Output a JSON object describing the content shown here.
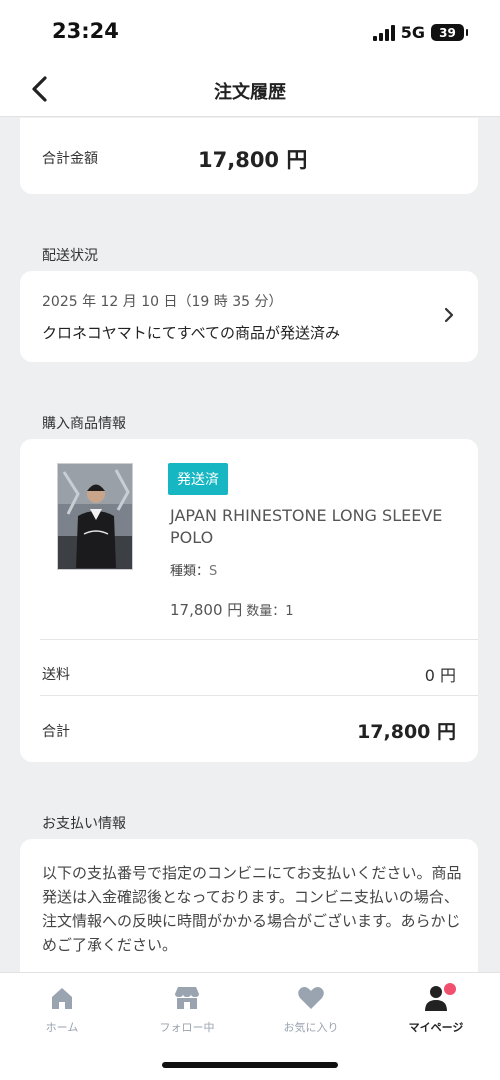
{
  "status_bar": {
    "time": "23:24",
    "network": "5G",
    "battery": "39"
  },
  "nav": {
    "title": "注文履歴"
  },
  "order_total": {
    "label": "合計金額",
    "value": "17,800 円"
  },
  "shipping": {
    "section_title": "配送状況",
    "date": "2025 年 12 月 10 日（19 時 35 分）",
    "status": "クロネコヤマトにてすべての商品が発送済み"
  },
  "product": {
    "section_title": "購入商品情報",
    "badge": "発送済",
    "name": "JAPAN RHINESTONE LONG SLEEVE POLO",
    "variant_label": "種類：",
    "variant_value": "S",
    "price": "17,800 円",
    "quantity": "数量：1",
    "shipping_label": "送料",
    "shipping_value": "0 円",
    "total_label": "合計",
    "total_value": "17,800 円"
  },
  "payment": {
    "section_title": "お支払い情報",
    "text": "以下の支払番号で指定のコンビニにてお支払いください。商品発送は入金確認後となっております。コンビニ支払いの場合、注文情報への反映に時間がかかる場合がございます。あらかじめご了承ください。"
  },
  "tabs": [
    {
      "label": "ホーム",
      "icon": "home-icon"
    },
    {
      "label": "フォロー中",
      "icon": "store-icon"
    },
    {
      "label": "お気に入り",
      "icon": "heart-icon"
    },
    {
      "label": "マイページ",
      "icon": "user-icon"
    }
  ],
  "colors": {
    "badge": "#16b7c2",
    "tab_inactive": "#9aa3b0",
    "notification": "#f0506e"
  }
}
